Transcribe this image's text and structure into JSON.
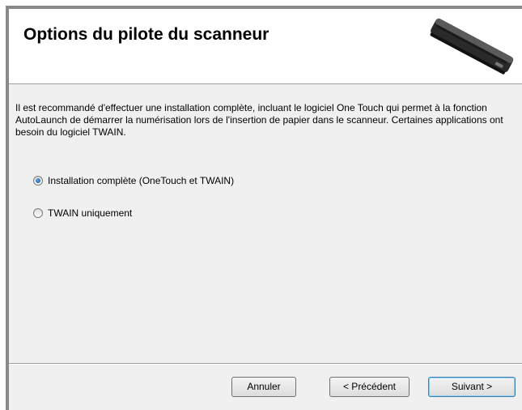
{
  "header": {
    "title": "Options du pilote du scanneur",
    "image_icon": "scanner-icon"
  },
  "content": {
    "description": "Il est recommandé d'effectuer une installation complète, incluant le logiciel One Touch qui permet à la fonction AutoLaunch de démarrer la numérisation lors de l'insertion de papier dans le scanneur. Certaines applications ont besoin du logiciel TWAIN.",
    "options": [
      {
        "label": "Installation complète (OneTouch et TWAIN)",
        "selected": true
      },
      {
        "label": "TWAIN uniquement",
        "selected": false
      }
    ]
  },
  "footer": {
    "cancel_label": "Annuler",
    "back_label": "< Précédent",
    "next_label": "Suivant >"
  }
}
